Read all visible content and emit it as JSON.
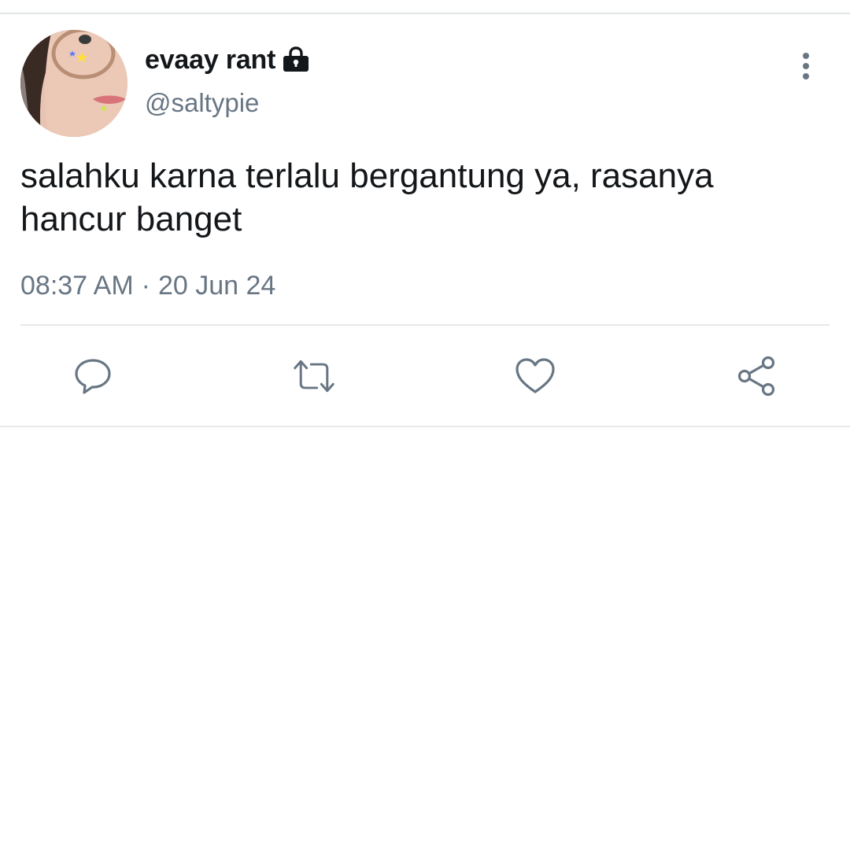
{
  "tweet": {
    "display_name": "evaay rant",
    "handle": "@saltypie",
    "text": "salahku karna terlalu bergantung ya, rasanya hancur banget",
    "time": "08:37 AM",
    "separator": "·",
    "date": "20 Jun 24",
    "protected": true
  },
  "icons": {
    "lock": "lock-icon",
    "more": "more-vertical-icon",
    "reply": "reply-icon",
    "retweet": "retweet-icon",
    "like": "heart-icon",
    "share": "share-icon"
  },
  "colors": {
    "text_primary": "#14171a",
    "text_secondary": "#687684",
    "divider": "#e6e8eb",
    "icon": "#687684"
  }
}
